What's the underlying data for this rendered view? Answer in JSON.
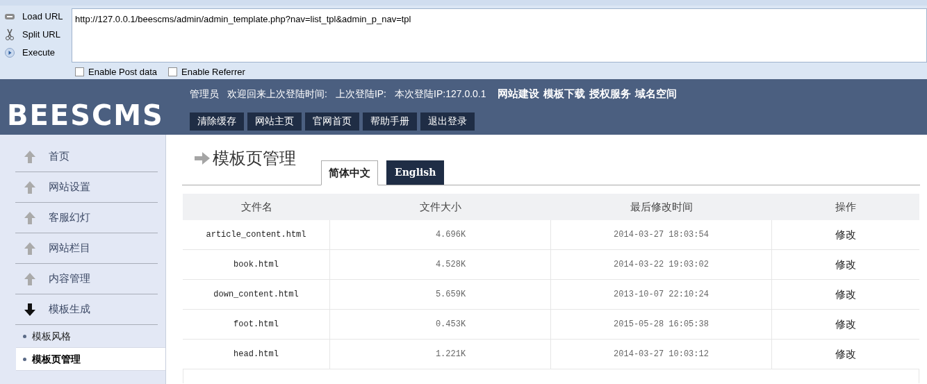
{
  "hackbar": {
    "actions": [
      {
        "kind": "load",
        "label": "Load URL"
      },
      {
        "kind": "split",
        "label": "Split URL"
      },
      {
        "kind": "execute",
        "label": "Execute"
      }
    ],
    "url": "http://127.0.0.1/beescms/admin/admin_template.php?nav=list_tpl&admin_p_nav=tpl",
    "options": [
      {
        "label": "Enable Post data",
        "checked": false
      },
      {
        "label": "Enable Referrer",
        "checked": false
      }
    ]
  },
  "header": {
    "logo": "BEESCMS",
    "info": [
      "管理员",
      "欢迎回来上次登陆时间:",
      "上次登陆IP:",
      "本次登陆IP:127.0.0.1"
    ],
    "links": [
      "网站建设",
      "模板下载",
      "授权服务",
      "域名空间"
    ],
    "buttons": [
      "清除缓存",
      "网站主页",
      "官网首页",
      "帮助手册",
      "退出登录"
    ]
  },
  "sidebar": {
    "items": [
      {
        "label": "首页",
        "expanded": false
      },
      {
        "label": "网站设置",
        "expanded": false
      },
      {
        "label": "客服幻灯",
        "expanded": false
      },
      {
        "label": "网站栏目",
        "expanded": false
      },
      {
        "label": "内容管理",
        "expanded": false
      },
      {
        "label": "模板生成",
        "expanded": true,
        "children": [
          {
            "label": "模板风格",
            "selected": false
          },
          {
            "label": "模板页管理",
            "selected": true
          }
        ]
      }
    ]
  },
  "page": {
    "title": "模板页管理",
    "tabs": [
      {
        "label": "简体中文",
        "selected": true
      },
      {
        "label": "English",
        "selected": false
      }
    ]
  },
  "table": {
    "columns": [
      "文件名",
      "文件大小",
      "最后修改时间",
      "操作"
    ],
    "rows": [
      {
        "name": "article_content.html",
        "size": "4.696K",
        "modified": "2014-03-27 18:03:54",
        "action": "修改"
      },
      {
        "name": "book.html",
        "size": "4.528K",
        "modified": "2014-03-22 19:03:02",
        "action": "修改"
      },
      {
        "name": "down_content.html",
        "size": "5.659K",
        "modified": "2013-10-07 22:10:24",
        "action": "修改"
      },
      {
        "name": "foot.html",
        "size": "0.453K",
        "modified": "2015-05-28 16:05:38",
        "action": "修改"
      },
      {
        "name": "head.html",
        "size": "1.221K",
        "modified": "2014-03-27 10:03:12",
        "action": "修改"
      }
    ]
  }
}
